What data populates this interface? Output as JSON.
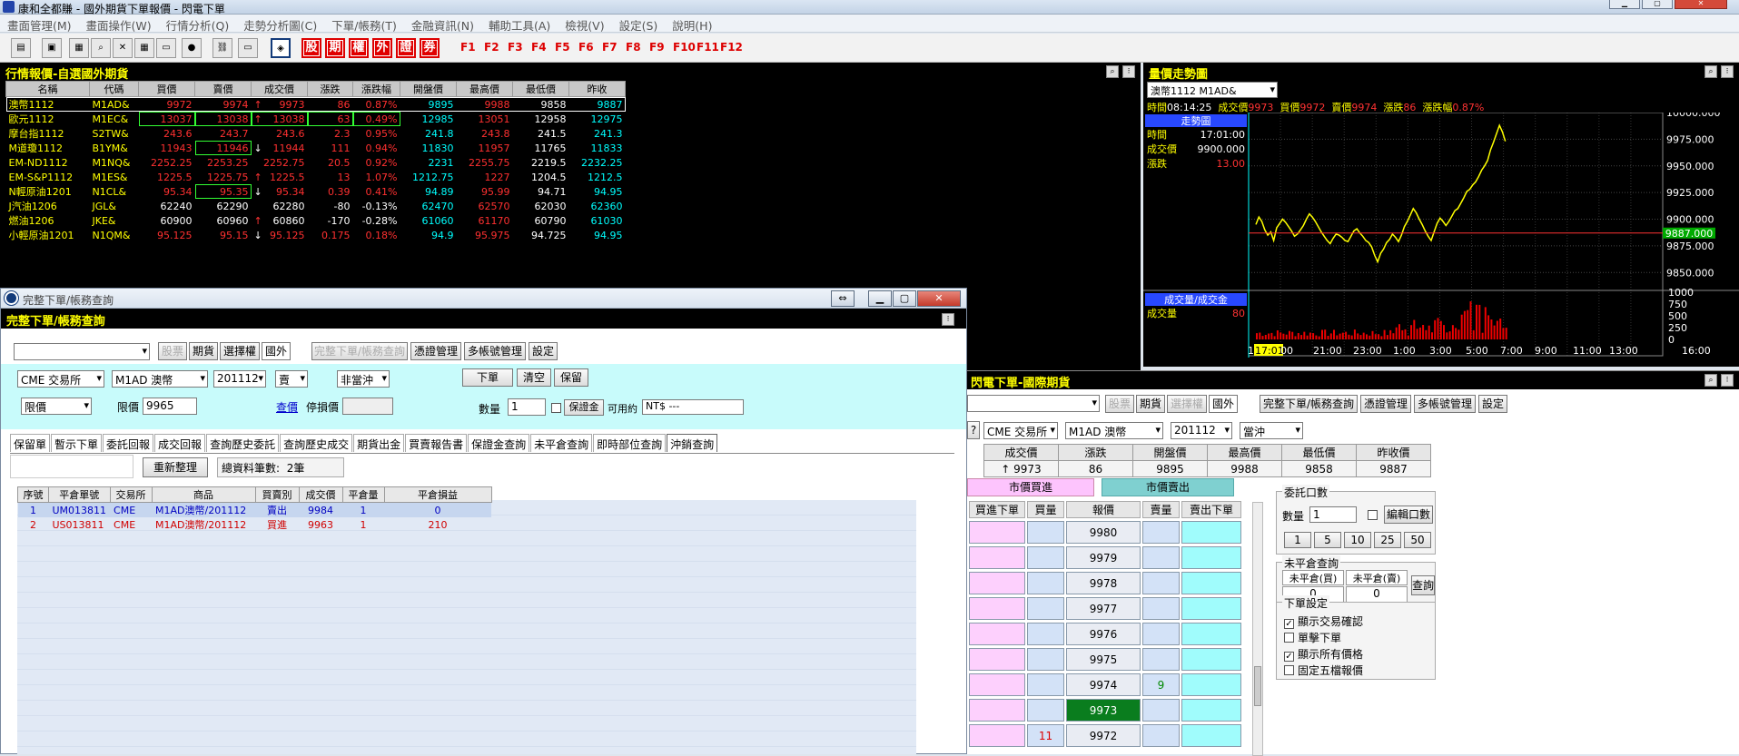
{
  "app": {
    "title": "康和全都賺 - 國外期貨下單報價 - 閃電下單"
  },
  "menu": [
    "畫面管理(M)",
    "畫面操作(W)",
    "行情分析(Q)",
    "走勢分析圖(C)",
    "下單/帳務(T)",
    "金融資訊(N)",
    "輔助工具(A)",
    "檢視(V)",
    "設定(S)",
    "說明(H)"
  ],
  "toolbar": {
    "red_buttons": [
      "股",
      "期",
      "權",
      "外",
      "證",
      "券"
    ],
    "fkeys": [
      "F1",
      "F2",
      "F3",
      "F4",
      "F5",
      "F6",
      "F7",
      "F8",
      "F9",
      "F10",
      "F11",
      "F12"
    ]
  },
  "quote": {
    "title": "行情報價-自選國外期貨",
    "columns": [
      "名稱",
      "代碼",
      "買價",
      "賣價",
      "成交價",
      "漲跌",
      "漲跌幅",
      "開盤價",
      "最高價",
      "最低價",
      "昨收"
    ],
    "rows": [
      {
        "name": "澳幣1112",
        "code": "M1AD&",
        "bid": "9972",
        "ask": "9974",
        "arrow": "↑",
        "last": "9973",
        "chg": "86",
        "pct": "0.87%",
        "open": "9895",
        "high": "9988",
        "low": "9858",
        "prev": "9887",
        "color": "r"
      },
      {
        "name": "歐元1112",
        "code": "M1EC&",
        "bid": "13037",
        "ask": "13038",
        "arrow": "↑",
        "last": "13038",
        "chg": "63",
        "pct": "0.49%",
        "open": "12985",
        "high": "13051",
        "low": "12958",
        "prev": "12975",
        "color": "r"
      },
      {
        "name": "摩台指1112",
        "code": "S2TW&",
        "bid": "243.6",
        "ask": "243.7",
        "arrow": "",
        "last": "243.6",
        "chg": "2.3",
        "pct": "0.95%",
        "open": "241.8",
        "high": "243.8",
        "low": "241.5",
        "prev": "241.3",
        "color": "r"
      },
      {
        "name": "M道瓊1112",
        "code": "B1YM&",
        "bid": "11943",
        "ask": "11946",
        "arrow": "↓",
        "last": "11944",
        "chg": "111",
        "pct": "0.94%",
        "open": "11830",
        "high": "11957",
        "low": "11765",
        "prev": "11833",
        "color": "r"
      },
      {
        "name": "EM-ND1112",
        "code": "M1NQ&",
        "bid": "2252.25",
        "ask": "2253.25",
        "arrow": "",
        "last": "2252.75",
        "chg": "20.5",
        "pct": "0.92%",
        "open": "2231",
        "high": "2255.75",
        "low": "2219.5",
        "prev": "2232.25",
        "color": "r"
      },
      {
        "name": "EM-S&P1112",
        "code": "M1ES&",
        "bid": "1225.5",
        "ask": "1225.75",
        "arrow": "↑",
        "last": "1225.5",
        "chg": "13",
        "pct": "1.07%",
        "open": "1212.75",
        "high": "1227",
        "low": "1204.5",
        "prev": "1212.5",
        "color": "r"
      },
      {
        "name": "N輕原油1201",
        "code": "N1CL&",
        "bid": "95.34",
        "ask": "95.35",
        "arrow": "↓",
        "last": "95.34",
        "chg": "0.39",
        "pct": "0.41%",
        "open": "94.89",
        "high": "95.99",
        "low": "94.71",
        "prev": "94.95",
        "color": "r"
      },
      {
        "name": "J汽油1206",
        "code": "JGL&",
        "bid": "62240",
        "ask": "62290",
        "arrow": "",
        "last": "62280",
        "chg": "-80",
        "pct": "-0.13%",
        "open": "62470",
        "high": "62570",
        "low": "62030",
        "prev": "62360",
        "color": "g"
      },
      {
        "name": "燃油1206",
        "code": "JKE&",
        "bid": "60900",
        "ask": "60960",
        "arrow": "↑",
        "last": "60860",
        "chg": "-170",
        "pct": "-0.28%",
        "open": "61060",
        "high": "61170",
        "low": "60790",
        "prev": "61030",
        "color": "g"
      },
      {
        "name": "小輕原油1201",
        "code": "N1QM&",
        "bid": "95.125",
        "ask": "95.15",
        "arrow": "↓",
        "last": "95.125",
        "chg": "0.175",
        "pct": "0.18%",
        "open": "94.9",
        "high": "95.975",
        "low": "94.725",
        "prev": "94.95",
        "color": "r"
      }
    ]
  },
  "chart": {
    "title": "量價走勢圖",
    "symbol": "澳幣1112   M1AD&",
    "info_time_label": "時間",
    "info_time": "08:14:25",
    "info_last_label": "成交價",
    "info_last": "9973",
    "info_bid_label": "買價",
    "info_bid": "9972",
    "info_ask_label": "賣價",
    "info_ask": "9974",
    "info_chg_label": "漲跌",
    "info_chg": "86",
    "info_pct_label": "漲跌幅",
    "info_pct": "0.87%",
    "side_title": "走勢圖",
    "side_time_label": "時間",
    "side_time": "17:01:00",
    "side_last_label": "成交價",
    "side_last": "9900.000",
    "side_chg_label": "漲跌",
    "side_chg": "13.00",
    "vol_title": "成交量/成交金",
    "vol_label": "成交量",
    "vol_value": "80",
    "price_ticks": [
      "10000.000",
      "9975.000",
      "9950.000",
      "9925.000",
      "9900.000",
      "9875.000",
      "9850.000"
    ],
    "current_price": "9887.000",
    "vol_ticks": [
      "1000",
      "750",
      "500",
      "250",
      "0"
    ],
    "time_ticks": [
      "17",
      "17:01",
      "00",
      "21:00",
      "23:00",
      "1:00",
      "3:00",
      "5:00",
      "7:00",
      "9:00",
      "11:00",
      "13:00",
      "16:00"
    ]
  },
  "chart_data": {
    "type": "line",
    "series": [
      {
        "values": [
          9895,
          9902,
          9898,
          9890,
          9885,
          9888,
          9880,
          9892,
          9896,
          9900,
          9897,
          9893,
          9889,
          9884,
          9886,
          9890,
          9894,
          9900,
          9905,
          9902,
          9898,
          9893,
          9888,
          9884,
          9880,
          9877,
          9882,
          9886,
          9885,
          9883,
          9880,
          9879,
          9884,
          9889,
          9891,
          9887,
          9884,
          9880,
          9878,
          9874,
          9866,
          9860,
          9868,
          9872,
          9878,
          9881,
          9886,
          9883,
          9879,
          9885,
          9893,
          9898,
          9904,
          9910,
          9906,
          9900,
          9895,
          9889,
          9884,
          9880,
          9888,
          9896,
          9901,
          9898,
          9894,
          9898,
          9903,
          9908,
          9910,
          9915,
          9920,
          9926,
          9928,
          9932,
          9935,
          9940,
          9946,
          9950,
          9955,
          9965,
          9972,
          9980,
          9988,
          9982,
          9973
        ]
      }
    ],
    "ylim": [
      9840,
      10000
    ],
    "reference_price": 9887
  },
  "order": {
    "window_title": "完整下單/帳務查詢",
    "subtitle": "完整下單/帳務查詢",
    "top_buttons": [
      "股票",
      "期貨",
      "選擇權",
      "國外"
    ],
    "top_right_buttons": [
      "完整下單/帳務查詢",
      "憑證管理",
      "多帳號管理",
      "設定"
    ],
    "exchange": "CME 交易所",
    "product": "M1AD  澳幣",
    "month": "201112",
    "side": "賣",
    "offset": "非當沖",
    "btn_order": "下單",
    "btn_clear": "清空",
    "btn_keep": "保留",
    "price_type": "限價",
    "price_label": "限價",
    "price_value": "9965",
    "query_link": "查價",
    "stop_label": "停損價",
    "qty_label": "數量",
    "qty_value": "1",
    "margin_btn": "保證金",
    "avail_label": "可用約",
    "avail_value": "NT$ ---",
    "tabs": [
      "保留單",
      "暫示下單",
      "委託回報",
      "成交回報",
      "查詢歷史委託",
      "查詢歷史成交",
      "期貨出金",
      "買賣報告書",
      "保證金查詢",
      "未平倉查詢",
      "即時部位查詢",
      "沖銷查詢"
    ],
    "refresh_btn": "重新整理",
    "total_label": "總資料筆數:",
    "total_value": "2筆",
    "columns": [
      "序號",
      "平倉單號",
      "交易所",
      "商品",
      "買賣別",
      "成交價",
      "平倉量",
      "平倉損益"
    ],
    "rows": [
      {
        "no": "1",
        "id": "UM013811",
        "ex": "CME",
        "prod": "M1AD澳幣/201112",
        "side": "賣出",
        "price": "9984",
        "qty": "1",
        "pnl": "0",
        "color": "#0000c0"
      },
      {
        "no": "2",
        "id": "US013811",
        "ex": "CME",
        "prod": "M1AD澳幣/201112",
        "side": "買進",
        "price": "9963",
        "qty": "1",
        "pnl": "210",
        "color": "#d00000"
      }
    ]
  },
  "intl": {
    "title": "閃電下單-國際期貨",
    "buttons": [
      "股票",
      "期貨",
      "選擇權",
      "國外"
    ],
    "right_buttons": [
      "完整下單/帳務查詢",
      "憑證管理",
      "多帳號管理",
      "設定"
    ],
    "exchange": "CME 交易所",
    "product": "M1AD  澳幣",
    "month": "201112",
    "offset": "當沖",
    "cols": [
      "成交價",
      "漲跌",
      "開盤價",
      "最高價",
      "最低價",
      "昨收價"
    ],
    "vals": [
      "↑ 9973",
      "86",
      "9895",
      "9988",
      "9858",
      "9887"
    ],
    "mkt_buy": "市價買進",
    "mkt_sell": "市價賣出",
    "ladder_cols": [
      "買進下單",
      "買量",
      "報價",
      "賣量",
      "賣出下單"
    ],
    "ladder": [
      {
        "price": "9980",
        "bq": "",
        "sq": ""
      },
      {
        "price": "9979",
        "bq": "",
        "sq": ""
      },
      {
        "price": "9978",
        "bq": "",
        "sq": ""
      },
      {
        "price": "9977",
        "bq": "",
        "sq": ""
      },
      {
        "price": "9976",
        "bq": "",
        "sq": ""
      },
      {
        "price": "9975",
        "bq": "",
        "sq": ""
      },
      {
        "price": "9974",
        "bq": "",
        "sq": "9"
      },
      {
        "price": "9973",
        "bq": "",
        "sq": "",
        "cur": true
      },
      {
        "price": "9972",
        "bq": "11",
        "sq": ""
      }
    ],
    "lot_title": "委託口數",
    "lot_label": "數量",
    "lot_value": "1",
    "lot_edit": "編輯口數",
    "lot_quick": [
      "1",
      "5",
      "10",
      "25",
      "50"
    ],
    "pos_title": "未平倉查詢",
    "pos_buy": "未平倉(買)",
    "pos_sell": "未平倉(賣)",
    "pos_buy_v": "0",
    "pos_sell_v": "0",
    "pos_query": "查詢",
    "set_title": "下單設定",
    "settings": [
      {
        "label": "顯示交易確認",
        "checked": true
      },
      {
        "label": "單擊下單",
        "checked": false
      },
      {
        "label": "顯示所有價格",
        "checked": true
      },
      {
        "label": "固定五檔報價",
        "checked": false
      }
    ]
  }
}
